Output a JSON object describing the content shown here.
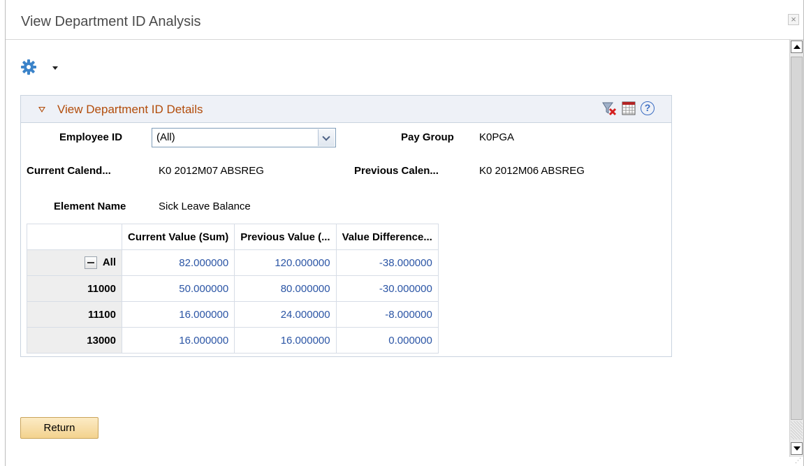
{
  "window": {
    "title": "View Department ID Analysis",
    "close_glyph": "×"
  },
  "toolbar": {
    "gear_icon": "gear-icon",
    "menu_icon": "caret-down-icon"
  },
  "groupbox": {
    "title": "View Department ID Details",
    "icons": [
      "clear-filter-icon",
      "grid-view-icon",
      "help-icon"
    ],
    "help_glyph": "?"
  },
  "fields": {
    "employee_id": {
      "label": "Employee ID",
      "value": "(All)"
    },
    "pay_group": {
      "label": "Pay Group",
      "value": "K0PGA"
    },
    "current_calendar": {
      "label": "Current Calend...",
      "value": "K0 2012M07 ABSREG"
    },
    "previous_calendar": {
      "label": "Previous Calen...",
      "value": "K0 2012M06 ABSREG"
    },
    "element_name": {
      "label": "Element Name",
      "value": "Sick Leave Balance"
    }
  },
  "grid": {
    "columns": [
      "Current Value (Sum)",
      "Previous Value (...",
      "Value Difference..."
    ],
    "rows": [
      {
        "label": "All",
        "values": [
          "82.000000",
          "120.000000",
          "-38.000000"
        ]
      },
      {
        "label": "11000",
        "values": [
          "50.000000",
          "80.000000",
          "-30.000000"
        ]
      },
      {
        "label": "11100",
        "values": [
          "16.000000",
          "24.000000",
          "-8.000000"
        ]
      },
      {
        "label": "13000",
        "values": [
          "16.000000",
          "16.000000",
          "0.000000"
        ]
      }
    ]
  },
  "buttons": {
    "return_label": "Return"
  },
  "colors": {
    "accent": "#b24c0a",
    "link": "#2b55a5",
    "button": "#f3d28e"
  }
}
